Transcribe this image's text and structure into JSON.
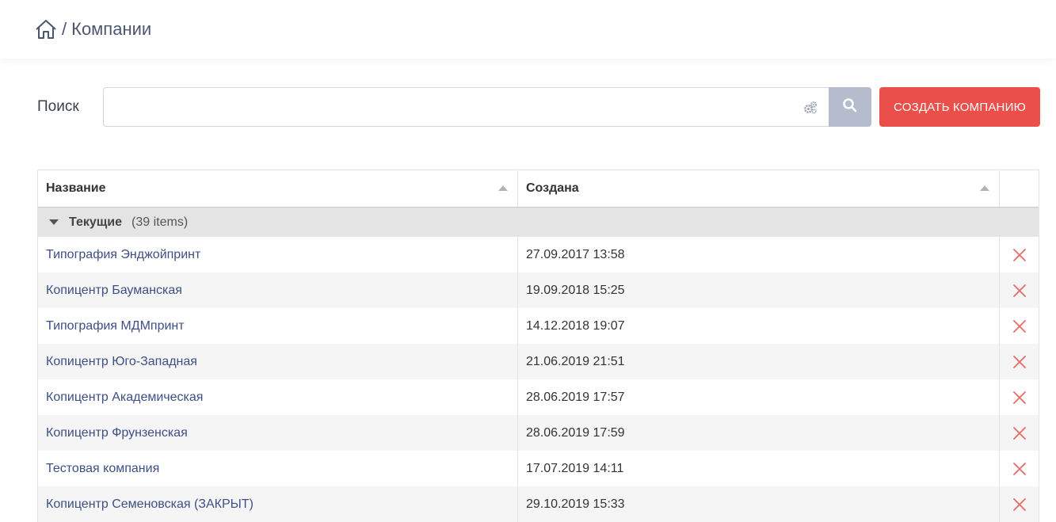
{
  "breadcrumb": {
    "separator": "/",
    "title": "Компании"
  },
  "search": {
    "label": "Поиск",
    "value": "",
    "placeholder": ""
  },
  "toolbar": {
    "create_label": "СОЗДАТЬ КОМПАНИЮ"
  },
  "table": {
    "columns": [
      "Название",
      "Создана"
    ],
    "group": {
      "name": "Текущие",
      "count": "(39 items)"
    },
    "rows": [
      {
        "name": "Типография Энджойпринт",
        "created": "27.09.2017 13:58"
      },
      {
        "name": "Копицентр Бауманская",
        "created": "19.09.2018 15:25"
      },
      {
        "name": "Типография МДМпринт",
        "created": "14.12.2018 19:07"
      },
      {
        "name": "Копицентр Юго-Западная",
        "created": "21.06.2019 21:51"
      },
      {
        "name": "Копицентр Академическая",
        "created": "28.06.2019 17:57"
      },
      {
        "name": "Копицентр Фрунзенская",
        "created": "28.06.2019 17:59"
      },
      {
        "name": "Тестовая компания",
        "created": "17.07.2019 14:11"
      },
      {
        "name": "Копицентр Семеновская (ЗАКРЫТ)",
        "created": "29.10.2019 15:33"
      }
    ]
  },
  "colors": {
    "accent": "#ea4f4a",
    "link": "#3e4f86",
    "search_button": "#b5bccd"
  },
  "icons": {
    "home": "home-icon",
    "gear": "gear-icon",
    "search": "search-icon",
    "delete": "close-icon",
    "sort": "sort-up-icon",
    "group_toggle": "caret-down-icon"
  }
}
